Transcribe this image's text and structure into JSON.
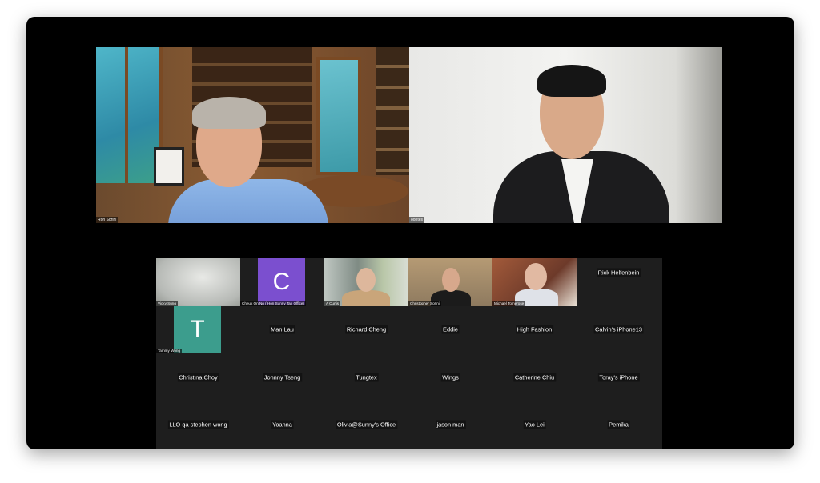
{
  "speakers": [
    {
      "name": "Ron Sorini"
    },
    {
      "name": "oontes"
    }
  ],
  "gallery": [
    {
      "name": "Vicky Sung",
      "kind": "video"
    },
    {
      "name": "Cheuk On Ng ( Hon Sunny Tan Office)",
      "kind": "avatar",
      "initial": "C",
      "color": "#7b4fcf"
    },
    {
      "name": "A Curtis",
      "kind": "video"
    },
    {
      "name": "Christopher Sorini",
      "kind": "video"
    },
    {
      "name": "Michael Tomerose",
      "kind": "video"
    },
    {
      "name": "Rick Helfenbein",
      "kind": "name"
    },
    {
      "name": "Tammy Wong",
      "kind": "avatar",
      "initial": "T",
      "color": "#3c9d8d"
    },
    {
      "name": "Man Lau",
      "kind": "name"
    },
    {
      "name": "Richard Cheng",
      "kind": "name"
    },
    {
      "name": "Eddie",
      "kind": "name"
    },
    {
      "name": "High Fashion",
      "kind": "name"
    },
    {
      "name": "Calvin's iPhone13",
      "kind": "name"
    },
    {
      "name": "Christina Choy",
      "kind": "name"
    },
    {
      "name": "Johnny Tseng",
      "kind": "name"
    },
    {
      "name": "Tungtex",
      "kind": "name"
    },
    {
      "name": "Wings",
      "kind": "name"
    },
    {
      "name": "Catherine Chiu",
      "kind": "name"
    },
    {
      "name": "Toray's iPhone",
      "kind": "name"
    },
    {
      "name": "LLO qa stephen wong",
      "kind": "name"
    },
    {
      "name": "Yoanna",
      "kind": "name"
    },
    {
      "name": "Olivia@Sunny's Office",
      "kind": "name"
    },
    {
      "name": "jason man",
      "kind": "name"
    },
    {
      "name": "Yao Lei",
      "kind": "name"
    },
    {
      "name": "Pemika",
      "kind": "name"
    }
  ]
}
